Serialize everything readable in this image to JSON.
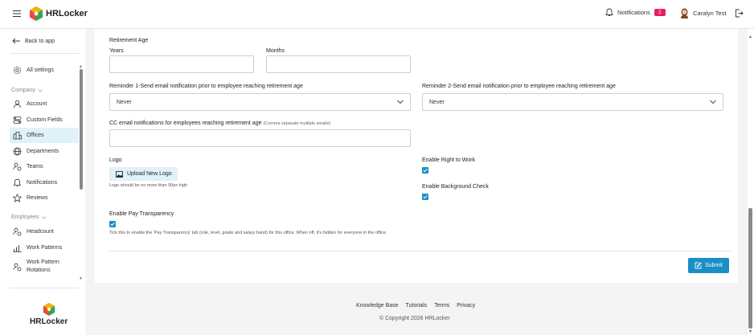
{
  "app": {
    "name": "HRLocker"
  },
  "header": {
    "notifications_label": "Notifications",
    "notifications_count": "1",
    "user_name": "Caralyn Test",
    "badge_color": "#e91e63"
  },
  "sidebar": {
    "back_label": "Back to app",
    "all_settings": "All settings",
    "company_group": "Company",
    "company_items": [
      {
        "label": "Account",
        "icon": "user-icon"
      },
      {
        "label": "Custom Fields",
        "icon": "toggles-icon"
      },
      {
        "label": "Offices",
        "icon": "building-icon",
        "active": true
      },
      {
        "label": "Departments",
        "icon": "globe-icon"
      },
      {
        "label": "Teams",
        "icon": "team-icon"
      },
      {
        "label": "Notifications",
        "icon": "bell-icon"
      },
      {
        "label": "Reviews",
        "icon": "star-icon"
      }
    ],
    "employees_group": "Employees",
    "employee_items": [
      {
        "label": "Headcount",
        "icon": "headcount-icon"
      },
      {
        "label": "Work Patterns",
        "icon": "chart-icon"
      },
      {
        "label": "Work Pattern Rotations",
        "icon": "rotation-icon"
      }
    ]
  },
  "form": {
    "retirement_age_label": "Retirement Age",
    "years_label": "Years",
    "years_value": "",
    "months_label": "Months",
    "months_value": "",
    "reminder1_label": "Reminder 1-Send email notification prior to employee reaching retirement age",
    "reminder1_value": "Never",
    "reminder2_label": "Reminder 2-Send email notification prior to employee reaching retirement age",
    "reminder2_value": "Never",
    "cc_label": "CC email notifications for employees reaching retirement age",
    "cc_hint": "(Comma separate multiple emails)",
    "cc_value": "",
    "logo_label": "Logo",
    "upload_label": "Upload New Logo",
    "logo_hint": "Logo should be no more than 90px high",
    "right_to_work_label": "Enable Right to Work",
    "right_to_work_checked": true,
    "background_check_label": "Enable Background Check",
    "background_check_checked": true,
    "pay_transparency_label": "Enable Pay Transparency",
    "pay_transparency_checked": true,
    "pay_transparency_hint": "Tick this to enable the 'Pay Transparency' tab (role, level, grade and salary band) for this office. When off, it's hidden for everyone in the office.",
    "submit_label": "Submit",
    "accent_color": "#1a8fc6"
  },
  "footer": {
    "links": [
      "Knowledge Base",
      "Tutorials",
      "Terms",
      "Privacy"
    ],
    "copyright": "© Copyright 2026 HRLocker"
  }
}
